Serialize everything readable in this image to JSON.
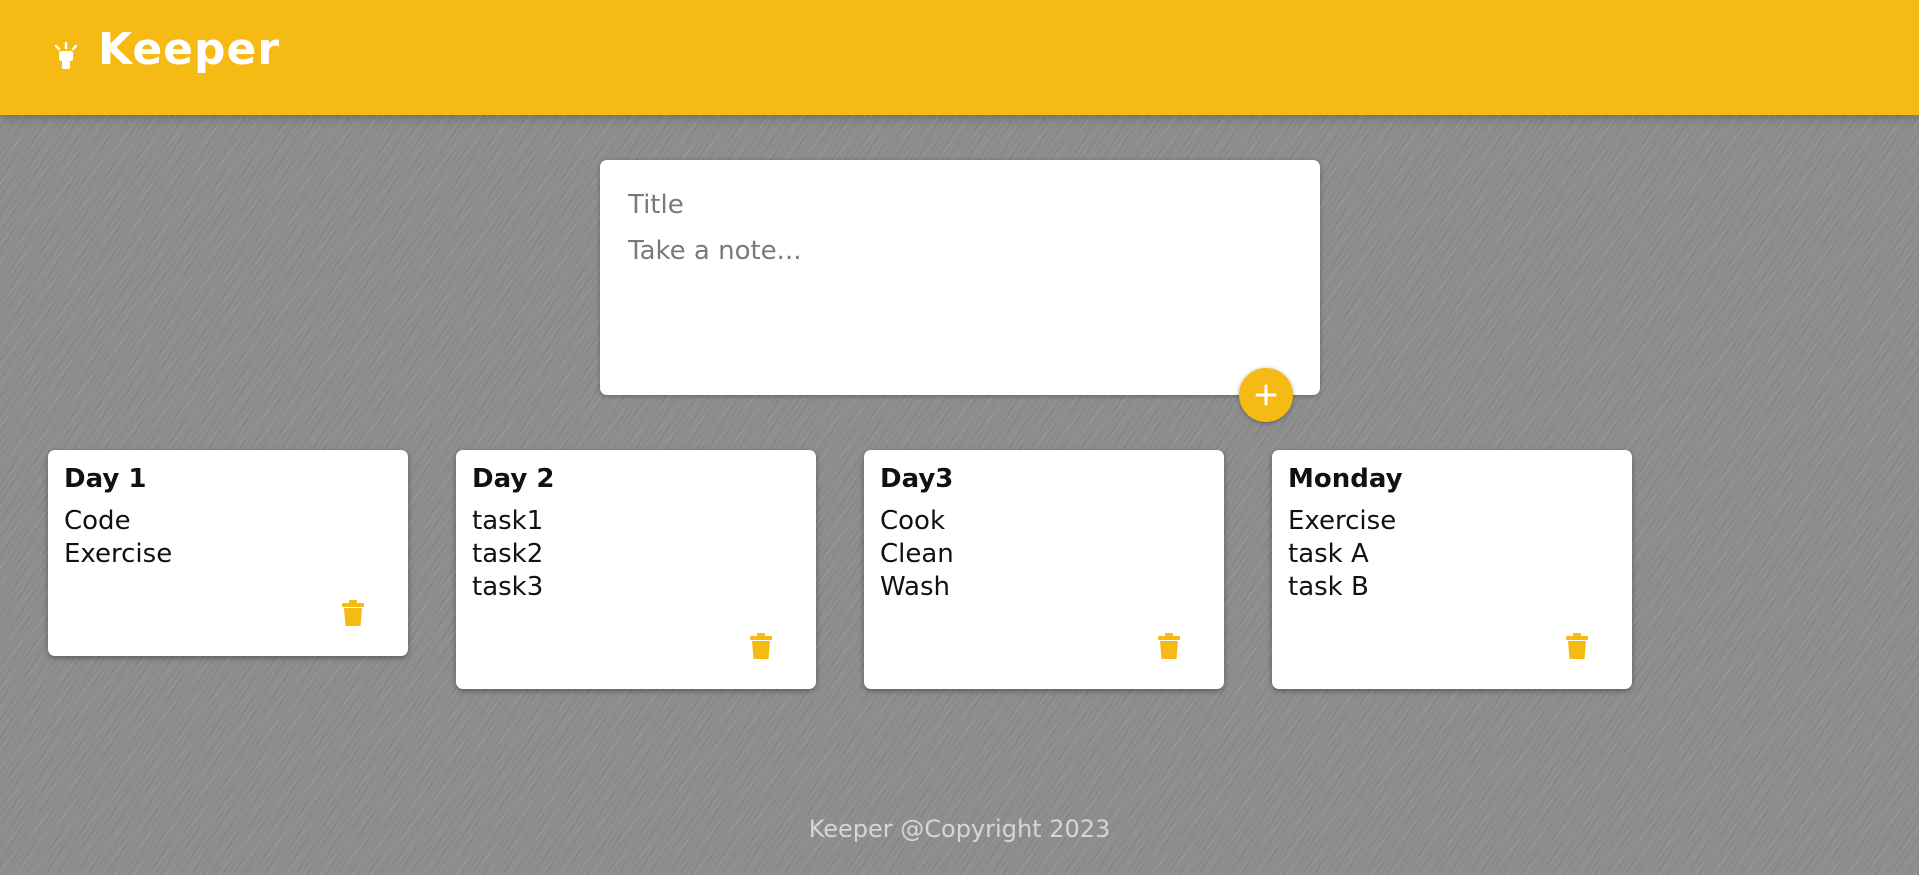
{
  "header": {
    "app_title": "Keeper",
    "logo_icon": "lightbulb-icon",
    "brand_color": "#f5ba13"
  },
  "create_area": {
    "title_placeholder": "Title",
    "content_placeholder": "Take a note...",
    "add_button_icon": "plus-icon"
  },
  "notes": [
    {
      "title": "Day 1",
      "lines": [
        "Code",
        "Exercise"
      ],
      "delete_icon": "trash-icon"
    },
    {
      "title": "Day 2",
      "lines": [
        "task1",
        "task2",
        "task3"
      ],
      "delete_icon": "trash-icon"
    },
    {
      "title": "Day3",
      "lines": [
        "Cook",
        "Clean",
        "Wash"
      ],
      "delete_icon": "trash-icon"
    },
    {
      "title": "Monday",
      "lines": [
        "Exercise",
        "task A",
        "task B"
      ],
      "delete_icon": "trash-icon"
    }
  ],
  "footer": {
    "text": "Keeper @Copyright 2023"
  }
}
